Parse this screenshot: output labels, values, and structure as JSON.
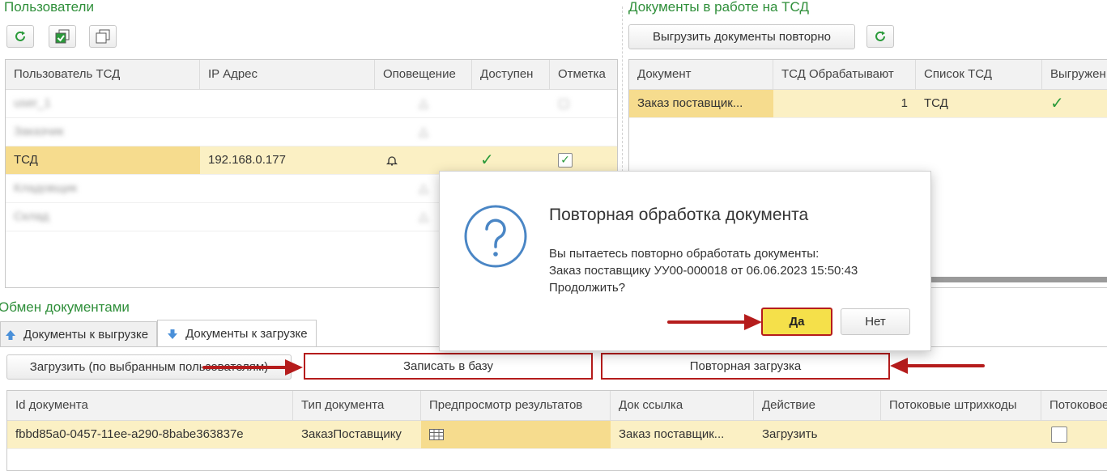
{
  "users_panel": {
    "title": "Пользователи",
    "columns": [
      "Пользователь ТСД",
      "IP Адрес",
      "Оповещение",
      "Доступен",
      "Отметка"
    ],
    "rows": [
      {
        "user": "user_1",
        "ip": "",
        "blurred": true
      },
      {
        "user": "Заказчик",
        "ip": "",
        "blurred": true
      },
      {
        "user": "ТСД",
        "ip": "192.168.0.177",
        "blurred": false,
        "available": "✓",
        "mark": "✓"
      },
      {
        "user": "Кладовщик",
        "ip": "",
        "blurred": true
      },
      {
        "user": "Склад",
        "ip": "",
        "blurred": true
      }
    ]
  },
  "docs_panel": {
    "title": "Документы в работе на ТСД",
    "reupload_button": "Выгрузить документы повторно",
    "columns": [
      "Документ",
      "ТСД Обрабатывают",
      "Список ТСД",
      "Выгружен"
    ],
    "rows": [
      {
        "document": "Заказ поставщик...",
        "count": "1",
        "tsd_list": "ТСД",
        "uploaded": "✓"
      }
    ]
  },
  "exchange": {
    "title": "Обмен документами",
    "tabs": [
      {
        "label": "Документы к выгрузке"
      },
      {
        "label": "Документы к загрузке"
      }
    ],
    "buttons": {
      "load_selected": "Загрузить (по выбранным пользователям)",
      "write_db": "Записать в базу",
      "reload": "Повторная загрузка"
    },
    "columns": [
      "Id документа",
      "Тип документа",
      "Предпросмотр результатов",
      "Док ссылка",
      "Действие",
      "Потоковые штрихкоды",
      "Потоковое"
    ],
    "rows": [
      {
        "id": "fbbd85a0-0457-11ee-a290-8babe363837e",
        "type": "ЗаказПоставщику",
        "preview": "",
        "link": "Заказ поставщик...",
        "action": "Загрузить",
        "stream_barcodes": "",
        "stream": ""
      }
    ]
  },
  "dialog": {
    "title": "Повторная обработка документа",
    "line1": "Вы пытаетесь повторно обработать документы:",
    "line2": "Заказ поставщику УУ00-000018 от 06.06.2023 15:50:43",
    "line3": "Продолжить?",
    "yes": "Да",
    "no": "Нет"
  },
  "colors": {
    "accent_green": "#2f8f3a",
    "selection": "#fbf0c4",
    "arrow_red": "#b51c1c",
    "highlight_yellow": "#f5e04a"
  }
}
